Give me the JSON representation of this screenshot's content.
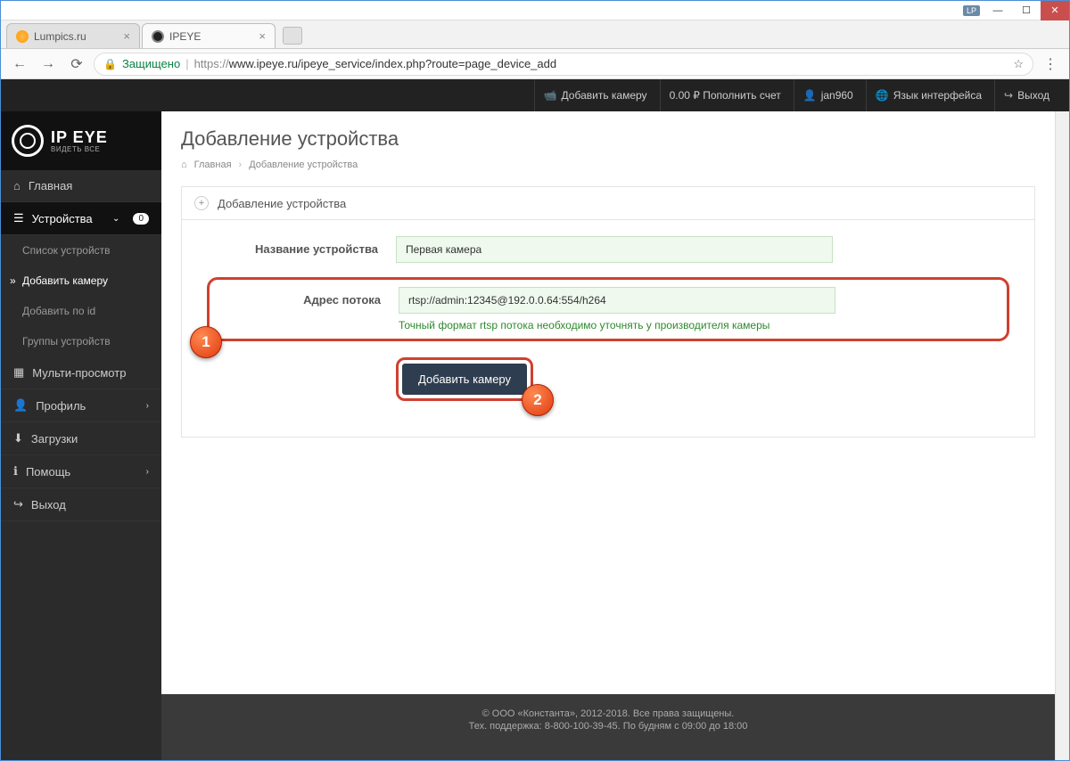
{
  "window": {
    "lp_badge": "LP"
  },
  "tabs": [
    {
      "title": "Lumpics.ru",
      "active": false
    },
    {
      "title": "IPEYE",
      "active": true
    }
  ],
  "address": {
    "secure_label": "Защищено",
    "proto": "https://",
    "url_rest": "www.ipeye.ru/ipeye_service/index.php?route=page_device_add"
  },
  "topnav": {
    "add_camera": "Добавить камеру",
    "balance": "0.00 ₽ Пополнить счет",
    "user": "jan960",
    "lang": "Язык интерфейса",
    "logout": "Выход"
  },
  "logo": {
    "main": "IP EYE",
    "sub": "ВИДЕТЬ ВСЕ"
  },
  "sidebar": {
    "home": "Главная",
    "devices": "Устройства",
    "devices_badge": "0",
    "device_list": "Список устройств",
    "add_camera": "Добавить камеру",
    "add_by_id": "Добавить по id",
    "device_groups": "Группы устройств",
    "multiview": "Мульти-просмотр",
    "profile": "Профиль",
    "downloads": "Загрузки",
    "help": "Помощь",
    "logout": "Выход"
  },
  "page": {
    "title": "Добавление устройства",
    "crumb_home": "Главная",
    "crumb_current": "Добавление устройства",
    "panel_title": "Добавление устройства"
  },
  "form": {
    "name_label": "Название устройства",
    "name_value": "Первая камера",
    "stream_label": "Адрес потока",
    "stream_value": "rtsp://admin:12345@192.0.0.64:554/h264",
    "stream_help": "Точный формат rtsp потока необходимо уточнять у производителя камеры",
    "submit": "Добавить камеру"
  },
  "callouts": {
    "one": "1",
    "two": "2"
  },
  "footer": {
    "line1": "© ООО «Константа», 2012-2018. Все права защищены.",
    "line2": "Тех. поддержка: 8-800-100-39-45. По будням с 09:00 до 18:00"
  }
}
